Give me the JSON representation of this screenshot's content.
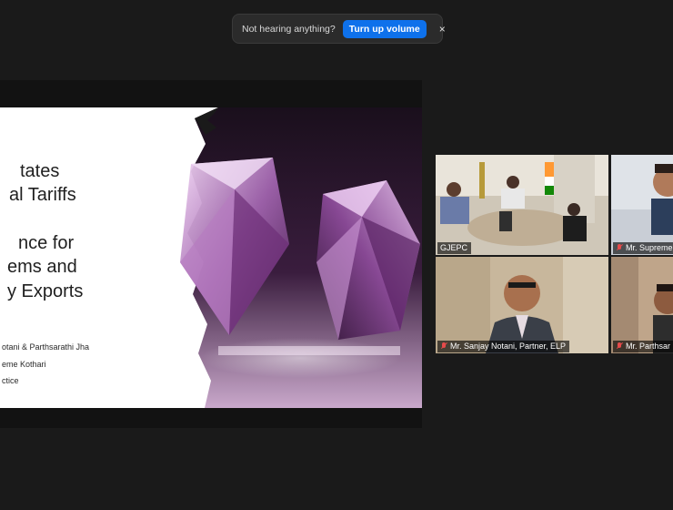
{
  "notification": {
    "message": "Not hearing anything?",
    "action_label": "Turn up volume",
    "close_glyph": "×"
  },
  "shared_slide": {
    "title_lines": [
      "tates",
      "al Tariffs",
      "nce for",
      "ems and",
      "y Exports"
    ],
    "meta_lines": [
      "otani & Parthsarathi Jha",
      "eme Kothari",
      "ctice"
    ]
  },
  "participants": [
    {
      "name": "GJEPC",
      "muted": false,
      "active_speaker": true
    },
    {
      "name": "Mr. Supreme",
      "muted": true,
      "active_speaker": false
    },
    {
      "name": "Mr. Sanjay Notani, Partner, ELP",
      "muted": true,
      "active_speaker": false
    },
    {
      "name": "Mr. Parthsar",
      "muted": true,
      "active_speaker": false
    }
  ],
  "colors": {
    "background": "#1a1a1a",
    "action_button": "#0e71eb",
    "active_speaker_border": "#c2d84a",
    "muted_mic": "#e64b4b"
  },
  "icons": [
    "close-icon",
    "mic-muted-icon"
  ]
}
